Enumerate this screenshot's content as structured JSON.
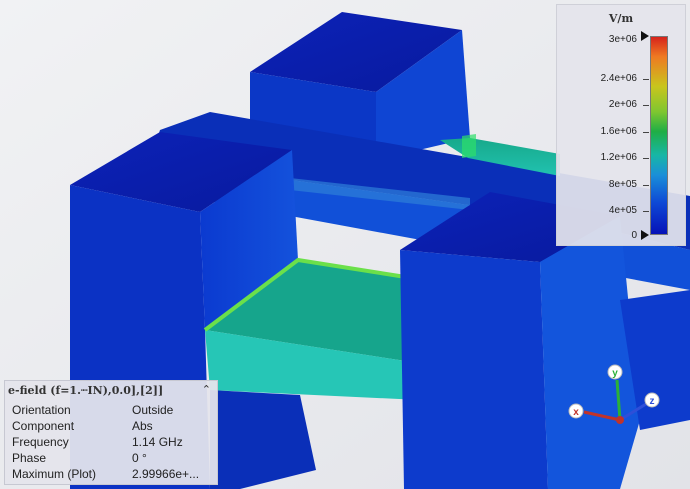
{
  "legend": {
    "unit": "V/m",
    "ticks": [
      "3e+06",
      "2.4e+06",
      "2e+06",
      "1.6e+06",
      "1.2e+06",
      "8e+05",
      "4e+05",
      "0"
    ]
  },
  "info": {
    "header": "e-field (f=1.┉IN),0.0],[2]]",
    "collapse_glyph": "⌃",
    "rows": [
      {
        "label": "Orientation",
        "value": "Outside"
      },
      {
        "label": "Component",
        "value": "Abs"
      },
      {
        "label": "Frequency",
        "value": "1.14 GHz"
      },
      {
        "label": "Phase",
        "value": "0 °"
      },
      {
        "label": "Maximum (Plot)",
        "value": "2.99966e+..."
      }
    ]
  },
  "axes": {
    "x": "x",
    "y": "y",
    "z": "z"
  },
  "colors": {
    "field_low": "#0a1fc8",
    "field_mid": "#1fb59a",
    "field_high": "#d6231b",
    "background": "#e9eaee"
  }
}
